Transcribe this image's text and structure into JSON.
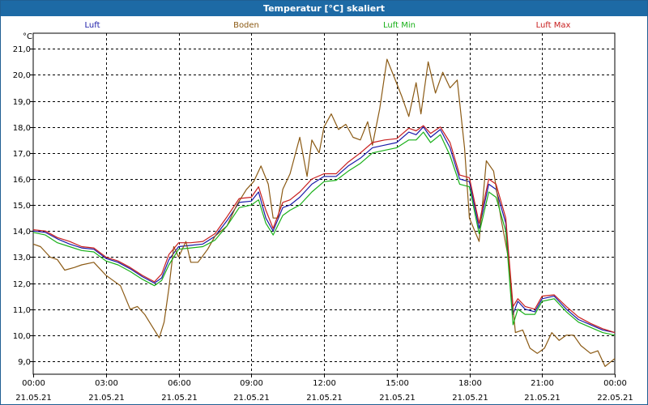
{
  "window": {
    "title": "Temperatur [°C] skaliert"
  },
  "chart_data": {
    "type": "line",
    "unit": "°C",
    "ylim": [
      8.5,
      21.6
    ],
    "yticks": [
      9.0,
      10.0,
      11.0,
      12.0,
      13.0,
      14.0,
      15.0,
      16.0,
      17.0,
      18.0,
      19.0,
      20.0,
      21.0
    ],
    "ytick_labels": [
      "9,0",
      "10,0",
      "11,0",
      "12,0",
      "13,0",
      "14,0",
      "15,0",
      "16,0",
      "17,0",
      "18,0",
      "19,0",
      "20,0",
      "21,0"
    ],
    "xlim": [
      0,
      24
    ],
    "xticks": [
      {
        "t": 0,
        "time": "00:00",
        "date": "21.05.21"
      },
      {
        "t": 3,
        "time": "03:00",
        "date": "21.05.21"
      },
      {
        "t": 6,
        "time": "06:00",
        "date": "21.05.21"
      },
      {
        "t": 9,
        "time": "09:00",
        "date": "21.05.21"
      },
      {
        "t": 12,
        "time": "12:00",
        "date": "21.05.21"
      },
      {
        "t": 15,
        "time": "15:00",
        "date": "21.05.21"
      },
      {
        "t": 18,
        "time": "18:00",
        "date": "21.05.21"
      },
      {
        "t": 21,
        "time": "21:00",
        "date": "21.05.21"
      },
      {
        "t": 24,
        "time": "00:00",
        "date": "22.05.21"
      }
    ],
    "grid": true,
    "legend_position": "top",
    "series": [
      {
        "name": "Luft",
        "color": "#1a1aa8",
        "points": [
          [
            0,
            14.0
          ],
          [
            0.5,
            13.95
          ],
          [
            1,
            13.7
          ],
          [
            1.5,
            13.5
          ],
          [
            2,
            13.35
          ],
          [
            2.5,
            13.3
          ],
          [
            3,
            12.95
          ],
          [
            3.5,
            12.8
          ],
          [
            4,
            12.55
          ],
          [
            4.5,
            12.25
          ],
          [
            5,
            12.0
          ],
          [
            5.3,
            12.2
          ],
          [
            5.6,
            12.9
          ],
          [
            6,
            13.4
          ],
          [
            6.5,
            13.45
          ],
          [
            7,
            13.5
          ],
          [
            7.5,
            13.8
          ],
          [
            8,
            14.4
          ],
          [
            8.5,
            15.1
          ],
          [
            9,
            15.15
          ],
          [
            9.3,
            15.5
          ],
          [
            9.6,
            14.5
          ],
          [
            9.9,
            14.0
          ],
          [
            10.3,
            14.9
          ],
          [
            10.6,
            15.0
          ],
          [
            11,
            15.3
          ],
          [
            11.5,
            15.8
          ],
          [
            12,
            16.1
          ],
          [
            12.5,
            16.1
          ],
          [
            13,
            16.5
          ],
          [
            13.5,
            16.8
          ],
          [
            14,
            17.2
          ],
          [
            14.5,
            17.3
          ],
          [
            15,
            17.4
          ],
          [
            15.5,
            17.8
          ],
          [
            15.8,
            17.7
          ],
          [
            16.1,
            18.0
          ],
          [
            16.4,
            17.6
          ],
          [
            16.8,
            17.9
          ],
          [
            17.2,
            17.2
          ],
          [
            17.6,
            16.0
          ],
          [
            18,
            15.9
          ],
          [
            18.4,
            14.1
          ],
          [
            18.8,
            15.8
          ],
          [
            19.1,
            15.6
          ],
          [
            19.5,
            14.3
          ],
          [
            19.8,
            10.8
          ],
          [
            20,
            11.3
          ],
          [
            20.3,
            11.0
          ],
          [
            20.7,
            10.9
          ],
          [
            21,
            11.4
          ],
          [
            21.5,
            11.5
          ],
          [
            22,
            11.0
          ],
          [
            22.5,
            10.6
          ],
          [
            23,
            10.4
          ],
          [
            23.5,
            10.2
          ],
          [
            24,
            10.1
          ]
        ]
      },
      {
        "name": "Boden",
        "color": "#8b5a14",
        "points": [
          [
            0,
            13.5
          ],
          [
            0.3,
            13.4
          ],
          [
            0.7,
            13.0
          ],
          [
            1,
            12.9
          ],
          [
            1.3,
            12.5
          ],
          [
            1.7,
            12.6
          ],
          [
            2,
            12.7
          ],
          [
            2.5,
            12.8
          ],
          [
            3,
            12.3
          ],
          [
            3.3,
            12.1
          ],
          [
            3.6,
            11.9
          ],
          [
            4,
            11.0
          ],
          [
            4.3,
            11.1
          ],
          [
            4.6,
            10.8
          ],
          [
            5,
            10.2
          ],
          [
            5.2,
            9.9
          ],
          [
            5.4,
            10.5
          ],
          [
            5.6,
            11.8
          ],
          [
            5.8,
            13.4
          ],
          [
            6,
            13.0
          ],
          [
            6.3,
            13.6
          ],
          [
            6.5,
            12.8
          ],
          [
            6.8,
            12.8
          ],
          [
            7.2,
            13.3
          ],
          [
            7.5,
            13.8
          ],
          [
            8,
            14.2
          ],
          [
            8.4,
            15.0
          ],
          [
            8.8,
            15.6
          ],
          [
            9.1,
            15.9
          ],
          [
            9.4,
            16.5
          ],
          [
            9.7,
            15.8
          ],
          [
            9.9,
            14.5
          ],
          [
            10.1,
            14.5
          ],
          [
            10.3,
            15.6
          ],
          [
            10.6,
            16.2
          ],
          [
            11,
            17.6
          ],
          [
            11.3,
            16.1
          ],
          [
            11.5,
            17.5
          ],
          [
            11.8,
            17.0
          ],
          [
            12,
            18.0
          ],
          [
            12.3,
            18.5
          ],
          [
            12.6,
            17.9
          ],
          [
            12.9,
            18.1
          ],
          [
            13.2,
            17.6
          ],
          [
            13.5,
            17.5
          ],
          [
            13.8,
            18.2
          ],
          [
            14,
            17.3
          ],
          [
            14.3,
            18.7
          ],
          [
            14.6,
            20.6
          ],
          [
            14.9,
            19.9
          ],
          [
            15.2,
            19.2
          ],
          [
            15.5,
            18.4
          ],
          [
            15.8,
            19.7
          ],
          [
            16,
            18.5
          ],
          [
            16.3,
            20.5
          ],
          [
            16.6,
            19.3
          ],
          [
            16.9,
            20.1
          ],
          [
            17.2,
            19.5
          ],
          [
            17.5,
            19.8
          ],
          [
            17.8,
            17.2
          ],
          [
            18,
            14.5
          ],
          [
            18.4,
            13.6
          ],
          [
            18.7,
            16.7
          ],
          [
            19,
            16.3
          ],
          [
            19.3,
            14.5
          ],
          [
            19.6,
            13.0
          ],
          [
            19.9,
            10.1
          ],
          [
            20.2,
            10.2
          ],
          [
            20.5,
            9.5
          ],
          [
            20.8,
            9.3
          ],
          [
            21.1,
            9.5
          ],
          [
            21.4,
            10.1
          ],
          [
            21.7,
            9.8
          ],
          [
            22,
            10.0
          ],
          [
            22.3,
            10.0
          ],
          [
            22.6,
            9.6
          ],
          [
            23,
            9.3
          ],
          [
            23.3,
            9.4
          ],
          [
            23.6,
            8.8
          ],
          [
            24,
            9.1
          ]
        ]
      },
      {
        "name": "Luft Min",
        "color": "#19b019",
        "points": [
          [
            0,
            13.95
          ],
          [
            0.5,
            13.85
          ],
          [
            1,
            13.55
          ],
          [
            1.5,
            13.4
          ],
          [
            2,
            13.25
          ],
          [
            2.5,
            13.2
          ],
          [
            3,
            12.85
          ],
          [
            3.5,
            12.7
          ],
          [
            4,
            12.45
          ],
          [
            4.5,
            12.15
          ],
          [
            5,
            11.9
          ],
          [
            5.3,
            12.1
          ],
          [
            5.6,
            12.7
          ],
          [
            6,
            13.3
          ],
          [
            6.5,
            13.35
          ],
          [
            7,
            13.4
          ],
          [
            7.5,
            13.65
          ],
          [
            8,
            14.2
          ],
          [
            8.5,
            14.9
          ],
          [
            9,
            15.0
          ],
          [
            9.3,
            15.2
          ],
          [
            9.6,
            14.3
          ],
          [
            9.9,
            13.85
          ],
          [
            10.3,
            14.6
          ],
          [
            10.6,
            14.8
          ],
          [
            11,
            15.0
          ],
          [
            11.5,
            15.5
          ],
          [
            12,
            15.9
          ],
          [
            12.5,
            15.95
          ],
          [
            13,
            16.3
          ],
          [
            13.5,
            16.6
          ],
          [
            14,
            17.0
          ],
          [
            14.5,
            17.1
          ],
          [
            15,
            17.2
          ],
          [
            15.5,
            17.5
          ],
          [
            15.8,
            17.5
          ],
          [
            16.1,
            17.8
          ],
          [
            16.4,
            17.4
          ],
          [
            16.8,
            17.7
          ],
          [
            17.2,
            16.9
          ],
          [
            17.6,
            15.8
          ],
          [
            18,
            15.7
          ],
          [
            18.4,
            13.9
          ],
          [
            18.8,
            15.5
          ],
          [
            19.1,
            15.3
          ],
          [
            19.5,
            14.0
          ],
          [
            19.8,
            10.4
          ],
          [
            20,
            11.0
          ],
          [
            20.3,
            10.8
          ],
          [
            20.7,
            10.8
          ],
          [
            21,
            11.3
          ],
          [
            21.5,
            11.4
          ],
          [
            22,
            10.9
          ],
          [
            22.5,
            10.5
          ],
          [
            23,
            10.3
          ],
          [
            23.5,
            10.1
          ],
          [
            24,
            10.0
          ]
        ]
      },
      {
        "name": "Luft Max",
        "color": "#c81e1e",
        "points": [
          [
            0,
            14.05
          ],
          [
            0.5,
            14.0
          ],
          [
            1,
            13.75
          ],
          [
            1.5,
            13.6
          ],
          [
            2,
            13.4
          ],
          [
            2.5,
            13.35
          ],
          [
            3,
            13.0
          ],
          [
            3.5,
            12.85
          ],
          [
            4,
            12.6
          ],
          [
            4.5,
            12.3
          ],
          [
            5,
            12.05
          ],
          [
            5.3,
            12.35
          ],
          [
            5.6,
            13.1
          ],
          [
            6,
            13.55
          ],
          [
            6.5,
            13.55
          ],
          [
            7,
            13.6
          ],
          [
            7.5,
            13.9
          ],
          [
            8,
            14.55
          ],
          [
            8.5,
            15.25
          ],
          [
            9,
            15.3
          ],
          [
            9.3,
            15.7
          ],
          [
            9.6,
            14.8
          ],
          [
            9.9,
            14.1
          ],
          [
            10.3,
            15.1
          ],
          [
            10.6,
            15.2
          ],
          [
            11,
            15.5
          ],
          [
            11.5,
            16.0
          ],
          [
            12,
            16.2
          ],
          [
            12.5,
            16.2
          ],
          [
            13,
            16.65
          ],
          [
            13.5,
            17.0
          ],
          [
            14,
            17.4
          ],
          [
            14.5,
            17.5
          ],
          [
            15,
            17.55
          ],
          [
            15.5,
            17.95
          ],
          [
            15.8,
            17.85
          ],
          [
            16.1,
            18.05
          ],
          [
            16.4,
            17.75
          ],
          [
            16.8,
            18.0
          ],
          [
            17.2,
            17.4
          ],
          [
            17.6,
            16.15
          ],
          [
            18,
            16.05
          ],
          [
            18.4,
            14.3
          ],
          [
            18.8,
            16.0
          ],
          [
            19.1,
            15.8
          ],
          [
            19.5,
            14.5
          ],
          [
            19.8,
            11.1
          ],
          [
            20,
            11.4
          ],
          [
            20.3,
            11.1
          ],
          [
            20.7,
            11.0
          ],
          [
            21,
            11.5
          ],
          [
            21.5,
            11.55
          ],
          [
            22,
            11.1
          ],
          [
            22.5,
            10.7
          ],
          [
            23,
            10.45
          ],
          [
            23.5,
            10.25
          ],
          [
            24,
            10.1
          ]
        ]
      }
    ]
  }
}
